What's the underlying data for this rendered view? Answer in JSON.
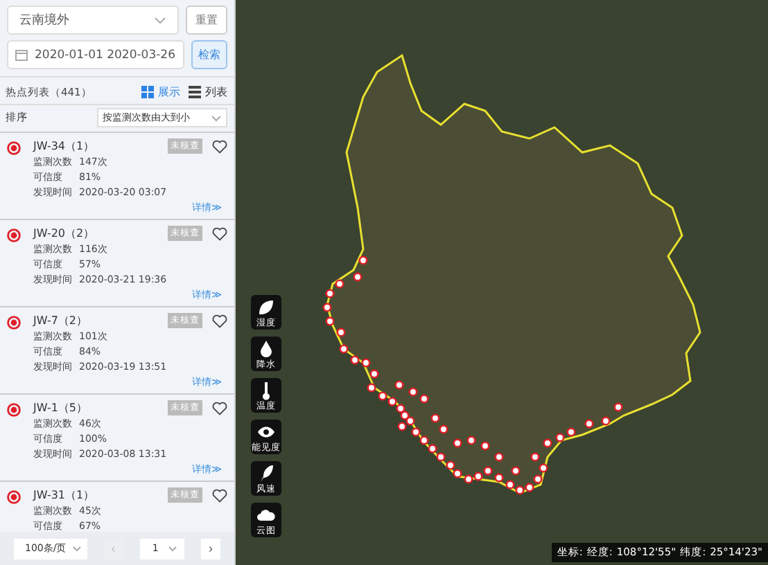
{
  "region_select": {
    "value": "云南境外"
  },
  "reset_button": "重置",
  "date_range": {
    "start": "2020-01-01",
    "end": "2020-03-26"
  },
  "search_button": "检索",
  "list_header": {
    "title": "热点列表（441）",
    "views": [
      {
        "label": "展示",
        "selected": true
      },
      {
        "label": "列表",
        "selected": false
      }
    ]
  },
  "sort": {
    "label": "排序",
    "value": "按监测次数由大到小"
  },
  "hotspots": [
    {
      "name": "JW-34",
      "count": "（1）",
      "status": "未核查",
      "favorite": false,
      "fields": [
        {
          "label": "监测次数",
          "value": "147次"
        },
        {
          "label": "可信度",
          "value": "81%"
        },
        {
          "label": "发现时间",
          "value": "2020-03-20 03:07"
        }
      ],
      "details": "详情≫"
    },
    {
      "name": "JW-20",
      "count": "（2）",
      "status": "未核查",
      "favorite": false,
      "fields": [
        {
          "label": "监测次数",
          "value": "116次"
        },
        {
          "label": "可信度",
          "value": "57%"
        },
        {
          "label": "发现时间",
          "value": "2020-03-21 19:36"
        }
      ],
      "details": "详情≫"
    },
    {
      "name": "JW-7",
      "count": "（2）",
      "status": "未核查",
      "favorite": false,
      "fields": [
        {
          "label": "监测次数",
          "value": "101次"
        },
        {
          "label": "可信度",
          "value": "84%"
        },
        {
          "label": "发现时间",
          "value": "2020-03-19 13:51"
        }
      ],
      "details": "详情≫"
    },
    {
      "name": "JW-1",
      "count": "（5）",
      "status": "未核查",
      "favorite": false,
      "fields": [
        {
          "label": "监测次数",
          "value": "46次"
        },
        {
          "label": "可信度",
          "value": "100%"
        },
        {
          "label": "发现时间",
          "value": "2020-03-08 13:31"
        }
      ],
      "details": "详情≫"
    },
    {
      "name": "JW-31",
      "count": "（1）",
      "status": "未核查",
      "favorite": false,
      "fields": [
        {
          "label": "监测次数",
          "value": "45次"
        },
        {
          "label": "可信度",
          "value": "67%"
        }
      ]
    }
  ],
  "pagination": {
    "page_size": "100条/页",
    "prev": "‹",
    "page": "1",
    "next": "›"
  },
  "layers": [
    {
      "kind": "leaf",
      "label": "湿度"
    },
    {
      "kind": "drop",
      "label": "降水"
    },
    {
      "kind": "thermo",
      "label": "温度"
    },
    {
      "kind": "eye",
      "label": "能见度"
    },
    {
      "kind": "feather",
      "label": "风速"
    },
    {
      "kind": "cloud",
      "label": "云图"
    }
  ],
  "coordinates": {
    "label": "坐标:",
    "lon_label": "经度:",
    "lon": "108°12'55\"",
    "lat_label": "纬度:",
    "lat": "25°14'23\""
  }
}
